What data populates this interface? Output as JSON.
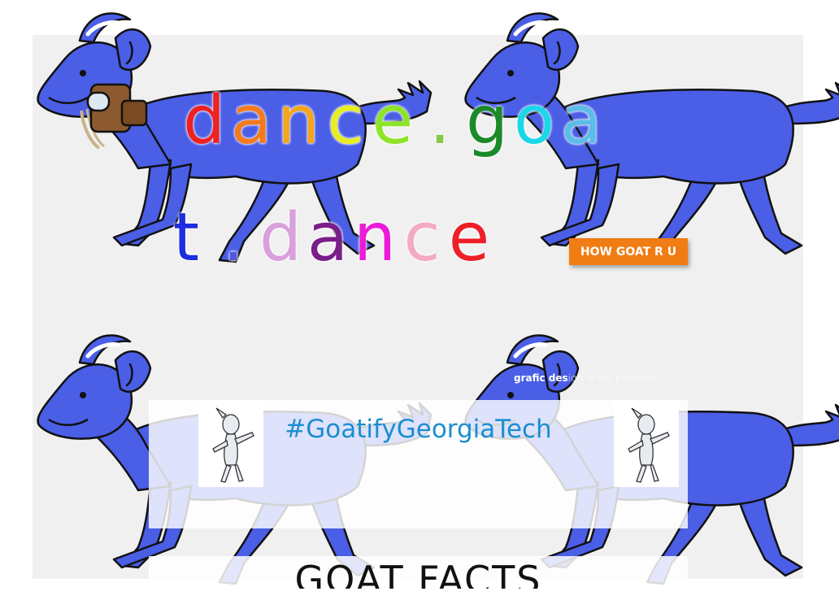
{
  "title": {
    "line1": [
      {
        "ch": "d",
        "color": "#ee2222"
      },
      {
        "ch": "a",
        "color": "#f57a1e"
      },
      {
        "ch": "n",
        "color": "#f4a51c"
      },
      {
        "ch": "c",
        "color": "#e9ee20"
      },
      {
        "ch": "e",
        "color": "#8ee427"
      },
      {
        "ch": ".",
        "color": "#87c94a"
      },
      {
        "ch": "g",
        "color": "#1a8a2a"
      },
      {
        "ch": "o",
        "color": "#1ad8e8"
      },
      {
        "ch": "a",
        "color": "#5bbde8"
      }
    ],
    "line2": [
      {
        "ch": "t",
        "color": "#1c2ee0"
      },
      {
        "ch": ".",
        "color": "#4f57e0"
      },
      {
        "ch": "d",
        "color": "#d9a0dc"
      },
      {
        "ch": "a",
        "color": "#7a1e8a"
      },
      {
        "ch": "n",
        "color": "#ec1ad8"
      },
      {
        "ch": "c",
        "color": "#f4a9c5"
      },
      {
        "ch": "e",
        "color": "#ee1f28"
      }
    ]
  },
  "button": {
    "label": "HOW GOAT R U"
  },
  "caption": {
    "strong": "grafic des",
    "faint": "ign is my passion!!!"
  },
  "hashtag": "#GoatifyGeorgiaTech",
  "facts_heading": "GOAT FACTS",
  "colors": {
    "goat_fill": "#4a5ee6",
    "button": "#f07c14",
    "hashtag": "#1a8ed1",
    "panel": "#f0f0f0"
  },
  "icons": [
    "blue-goat-illustration",
    "backpack-icon",
    "dancing-goat-icon"
  ]
}
